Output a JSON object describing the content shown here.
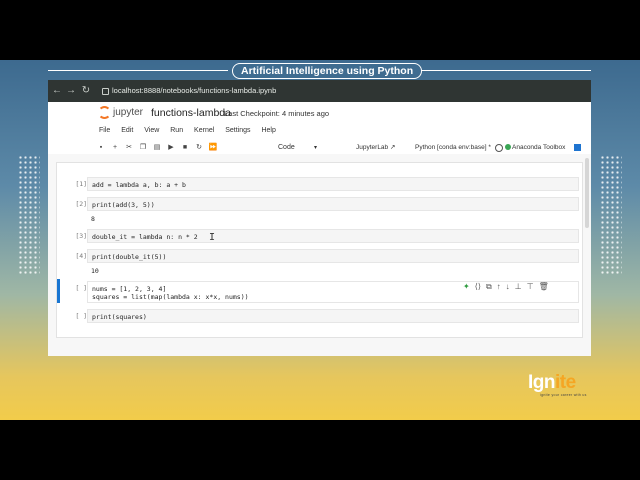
{
  "course": {
    "title": "Artificial Intelligence using Python"
  },
  "browser": {
    "back_icon": "arrow-left-icon",
    "forward_icon": "arrow-right-icon",
    "reload_icon": "reload-icon",
    "url": "localhost:8888/notebooks/functions-lambda.ipynb"
  },
  "jupyter": {
    "logo_text": "jupyter",
    "notebook_name": "functions-lambda",
    "checkpoint": "Last Checkpoint: 4 minutes ago",
    "menu": [
      "File",
      "Edit",
      "View",
      "Run",
      "Kernel",
      "Settings",
      "Help"
    ],
    "toolbar": {
      "cell_type": "Code",
      "jupyterlab": "JupyterLab",
      "kernel": "Python [conda env:base] *",
      "toolbox": "Anaconda Toolbox"
    },
    "cells": [
      {
        "prompt": "[1]:",
        "code": "add = lambda a, b: a + b",
        "output": ""
      },
      {
        "prompt": "[2]:",
        "code": "print(add(3, 5))",
        "output": "8"
      },
      {
        "prompt": "[3]:",
        "code": "double_it = lambda n: n * 2",
        "output": ""
      },
      {
        "prompt": "[4]:",
        "code": "print(double_it(5))",
        "output": "10"
      },
      {
        "prompt": "[ ]:",
        "code_line1": "nums = [1, 2, 3, 4]",
        "code_line2": "squares = list(map(lambda x: x*x, nums))",
        "output": ""
      },
      {
        "prompt": "[ ]:",
        "code": "print(squares)",
        "output": ""
      }
    ]
  },
  "brand": {
    "logo_a": "Ign",
    "logo_b": "ite",
    "tagline": "ignite your career with us"
  }
}
